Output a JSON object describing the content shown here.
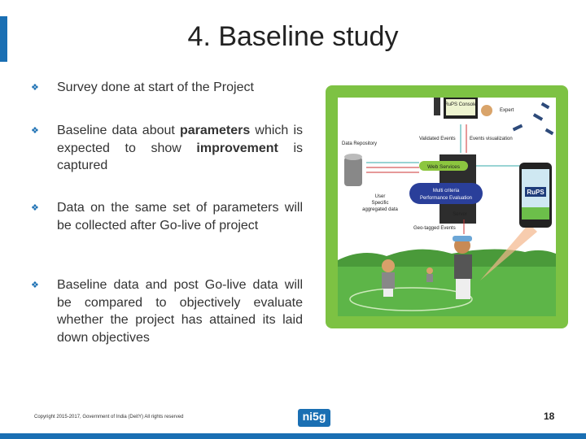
{
  "slide": {
    "title": "4. Baseline study",
    "bullets": [
      {
        "parts": [
          "Survey done at start of the Project"
        ]
      },
      {
        "parts": [
          "Baseline data about ",
          "parameters",
          " which is expected to show ",
          "improvement",
          " is captured"
        ]
      },
      {
        "parts": [
          "Data on the same set of parameters will be collected after Go-live of project"
        ]
      },
      {
        "parts": [
          "Baseline data and post Go-live data will be compared to objectively evaluate whether the project has attained its laid down objectives"
        ]
      }
    ],
    "bullet_icon": "four-diamond-bullet-icon",
    "accent_color": "#1a6fb3",
    "frame_color": "#7dc243"
  },
  "figure": {
    "console": "RuPS Console",
    "expert": "Expert",
    "data_repository": "Data Repository",
    "validated_events": "Validated Events",
    "events_visualization": "Events visualization",
    "web_services": "Web Services",
    "mcpe_line1": "Multi criteria",
    "mcpe_line2": "Performance Evaluation",
    "user_specific_1": "User",
    "user_specific_2": "Specific",
    "user_specific_3": "aggregated data",
    "server": "Server",
    "geo_tagged": "Geo-tagged Events",
    "phone_label": "RuPS"
  },
  "footer": {
    "copyright": "Copyright 2015-2017, Government of India (DeitY) All rights reserved",
    "logo": "ni5g",
    "page_number": "18"
  }
}
